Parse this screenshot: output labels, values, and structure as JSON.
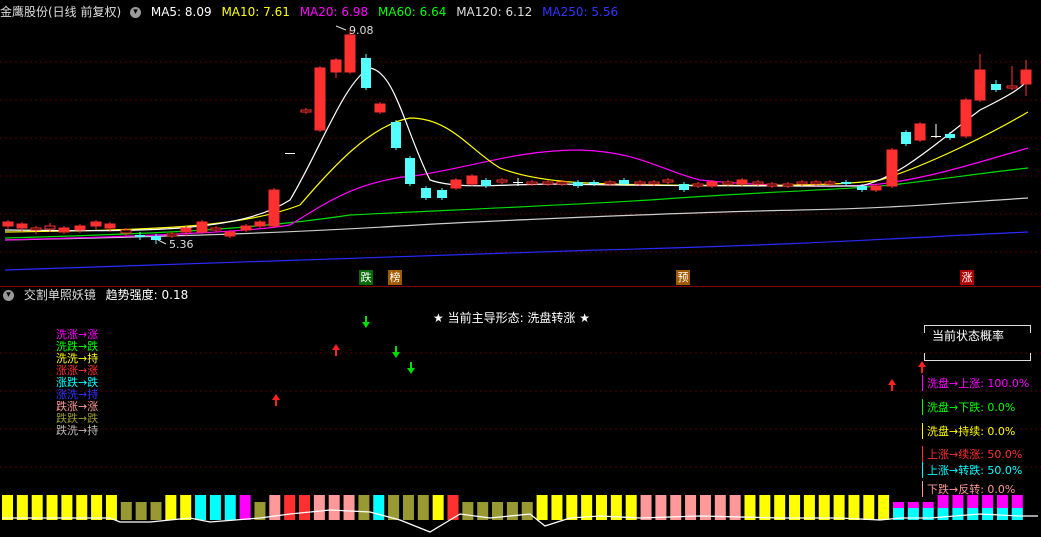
{
  "top_header": {
    "title": "金鹰股份(日线 前复权)",
    "ma_items": [
      {
        "label": "MA5: 8.09",
        "color": "#ffffff"
      },
      {
        "label": "MA10: 7.61",
        "color": "#ffff00"
      },
      {
        "label": "MA20: 6.98",
        "color": "#ff00ff"
      },
      {
        "label": "MA60: 6.64",
        "color": "#00ff00"
      },
      {
        "label": "MA120: 6.12",
        "color": "#dddddd"
      },
      {
        "label": "MA250: 5.56",
        "color": "#3333ff"
      }
    ]
  },
  "price_chart": {
    "high_label": "9.08",
    "low_label": "5.36",
    "signal_tags": [
      {
        "text": "跌",
        "bg": "#0a6a0a",
        "fg": "#ffffff"
      },
      {
        "text": "榜",
        "bg": "#a05a00",
        "fg": "#ffffff"
      },
      {
        "text": "预",
        "bg": "#a05a00",
        "fg": "#ffffff"
      },
      {
        "text": "涨",
        "bg": "#b00000",
        "fg": "#ffffff"
      }
    ]
  },
  "indicator_header": {
    "title": "交割单照妖镜",
    "strength_label": "趋势强度: 0.18"
  },
  "indicator": {
    "headline": "★ 当前主导形态: 洗盘转涨 ★",
    "legend": [
      {
        "text": "洗涨→涨",
        "color": "#ff00ff"
      },
      {
        "text": "洗跌→跌",
        "color": "#00ff00"
      },
      {
        "text": "洗洗→持",
        "color": "#ffff00"
      },
      {
        "text": "涨涨→涨",
        "color": "#ff3030"
      },
      {
        "text": "涨跌→跌",
        "color": "#00ffff"
      },
      {
        "text": "涨洗→持",
        "color": "#3333ff"
      },
      {
        "text": "跌涨→涨",
        "color": "#ff9999"
      },
      {
        "text": "跌跌→跌",
        "color": "#999933"
      },
      {
        "text": "跌洗→持",
        "color": "#bbbbbb"
      }
    ],
    "prob_title": "当前状态概率",
    "probabilities": [
      {
        "text": "洗盘→上涨: 100.0%",
        "color": "#ff00ff"
      },
      {
        "text": "洗盘→下跌: 0.0%",
        "color": "#00ff00"
      },
      {
        "text": "洗盘→持续: 0.0%",
        "color": "#ffff00"
      },
      {
        "text": "上涨→续涨: 50.0%",
        "color": "#ff3030"
      },
      {
        "text": "上涨→转跌: 50.0%",
        "color": "#00ffff"
      },
      {
        "text": "下跌→反转: 0.0%",
        "color": "#ff9999"
      }
    ]
  }
}
